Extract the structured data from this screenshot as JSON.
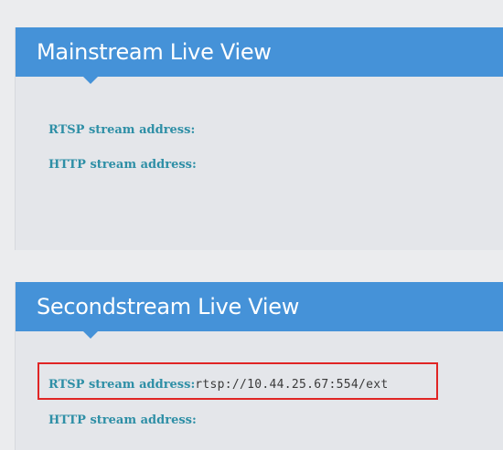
{
  "mainstream": {
    "title": "Mainstream Live View",
    "rtsp_label": "RTSP stream address:",
    "rtsp_value": "",
    "http_label": "HTTP stream address:",
    "http_value": ""
  },
  "secondstream": {
    "title": "Secondstream Live View",
    "rtsp_label": "RTSP stream address:",
    "rtsp_value": "rtsp://10.44.25.67:554/ext",
    "http_label": "HTTP stream address:",
    "http_value": ""
  },
  "colors": {
    "header": "#4592d8",
    "label": "#2e8fa6",
    "highlight": "#e02525",
    "panel": "#e4e6ea"
  }
}
